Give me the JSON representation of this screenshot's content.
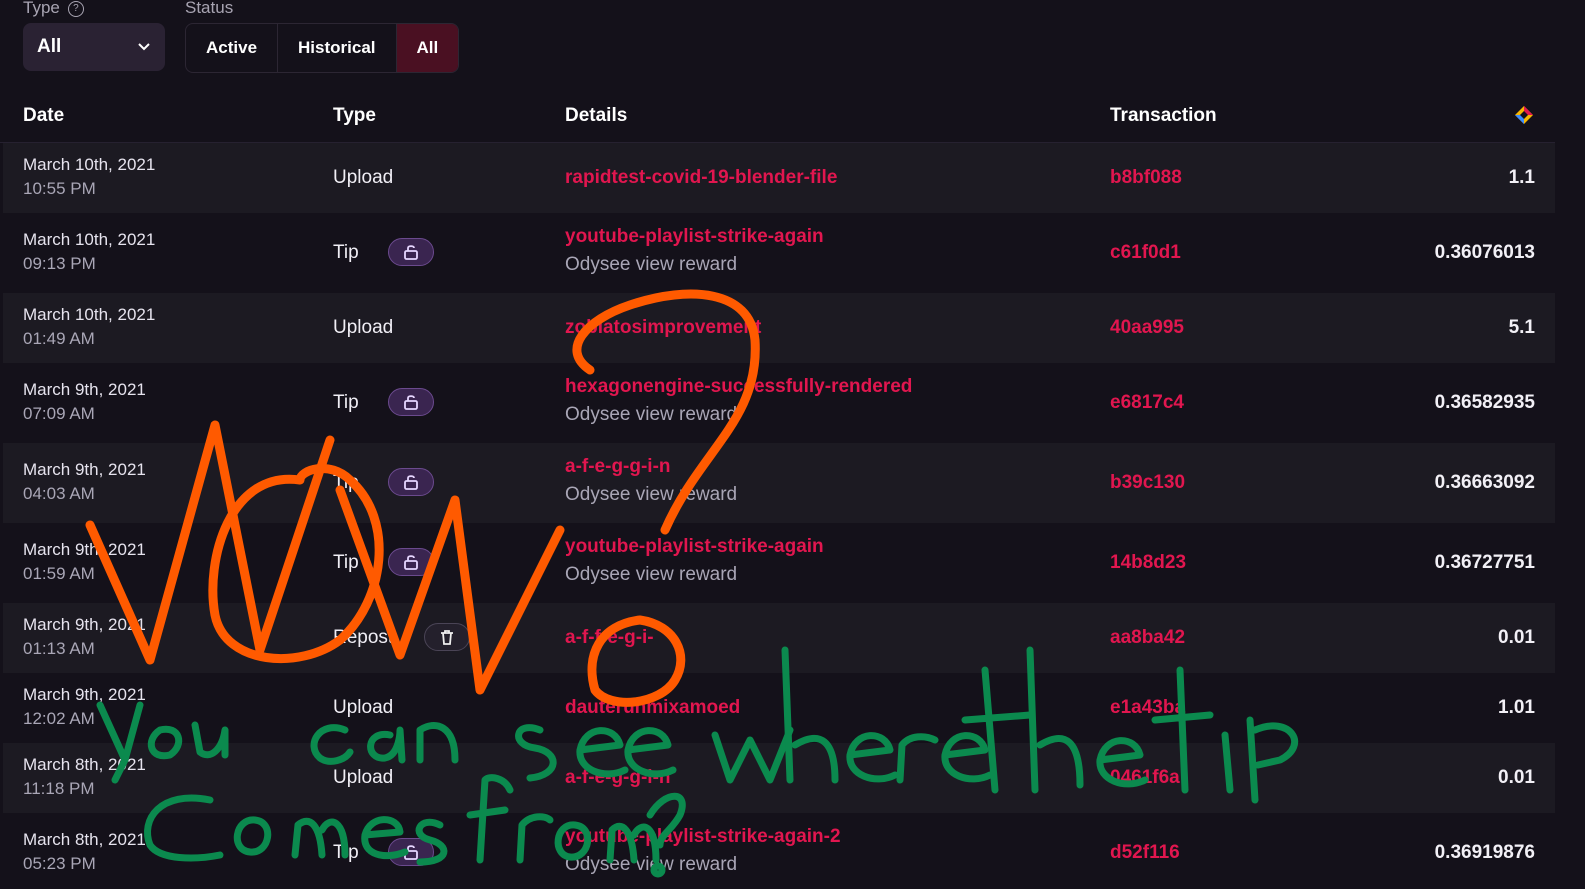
{
  "filters": {
    "type_label": "Type",
    "type_value": "All",
    "status_label": "Status",
    "status_options": [
      "Active",
      "Historical",
      "All"
    ],
    "status_selected": "All"
  },
  "columns": {
    "date": "Date",
    "type": "Type",
    "details": "Details",
    "transaction": "Transaction",
    "amount_icon": "lbc-credits-icon"
  },
  "rows": [
    {
      "date": "March 10th, 2021",
      "time": "10:55 PM",
      "type": "Upload",
      "action": "",
      "detail": "rapidtest-covid-19-blender-file",
      "sub": "",
      "txn": "b8bf088",
      "amount": "1.1"
    },
    {
      "date": "March 10th, 2021",
      "time": "09:13 PM",
      "type": "Tip",
      "action": "unlock",
      "detail": "youtube-playlist-strike-again",
      "sub": "Odysee view reward",
      "txn": "c61f0d1",
      "amount": "0.36076013"
    },
    {
      "date": "March 10th, 2021",
      "time": "01:49 AM",
      "type": "Upload",
      "action": "",
      "detail": "zoblatosimprovement",
      "sub": "",
      "txn": "40aa995",
      "amount": "5.1"
    },
    {
      "date": "March 9th, 2021",
      "time": "07:09 AM",
      "type": "Tip",
      "action": "unlock",
      "detail": "hexagonengine-successfully-rendered",
      "sub": "Odysee view reward",
      "txn": "e6817c4",
      "amount": "0.36582935"
    },
    {
      "date": "March 9th, 2021",
      "time": "04:03 AM",
      "type": "Tip",
      "action": "unlock",
      "detail": "a-f-e-g-g-i-n",
      "sub": "Odysee view reward",
      "txn": "b39c130",
      "amount": "0.36663092"
    },
    {
      "date": "March 9th, 2021",
      "time": "01:59 AM",
      "type": "Tip",
      "action": "unlock",
      "detail": "youtube-playlist-strike-again",
      "sub": "Odysee view reward",
      "txn": "14b8d23",
      "amount": "0.36727751"
    },
    {
      "date": "March 9th, 2021",
      "time": "01:13 AM",
      "type": "Repost",
      "action": "delete",
      "detail": "a-f-f-e-g-i-",
      "sub": "",
      "txn": "aa8ba42",
      "amount": "0.01"
    },
    {
      "date": "March 9th, 2021",
      "time": "12:02 AM",
      "type": "Upload",
      "action": "",
      "detail": "dauterunmixamoed",
      "sub": "",
      "txn": "e1a43ba",
      "amount": "1.01"
    },
    {
      "date": "March 8th, 2021",
      "time": "11:18 PM",
      "type": "Upload",
      "action": "",
      "detail": "a-f-e-g-g-i-n",
      "sub": "",
      "txn": "0461f6a",
      "amount": "0.01"
    },
    {
      "date": "March 8th, 2021",
      "time": "05:23 PM",
      "type": "Tip",
      "action": "unlock",
      "detail": "youtube-playlist-strike-again-2",
      "sub": "Odysee view reward",
      "txn": "d52f116",
      "amount": "0.36919876"
    }
  ],
  "annotation": {
    "big_word": "WOW?",
    "line1": "You can see where the tip",
    "line2": "Comes from?",
    "orange": "#ff5a00",
    "green": "#0b8a4e"
  },
  "colors": {
    "accent": "#e1164f",
    "background": "#14111a",
    "row_alt": "#1c1a22"
  }
}
